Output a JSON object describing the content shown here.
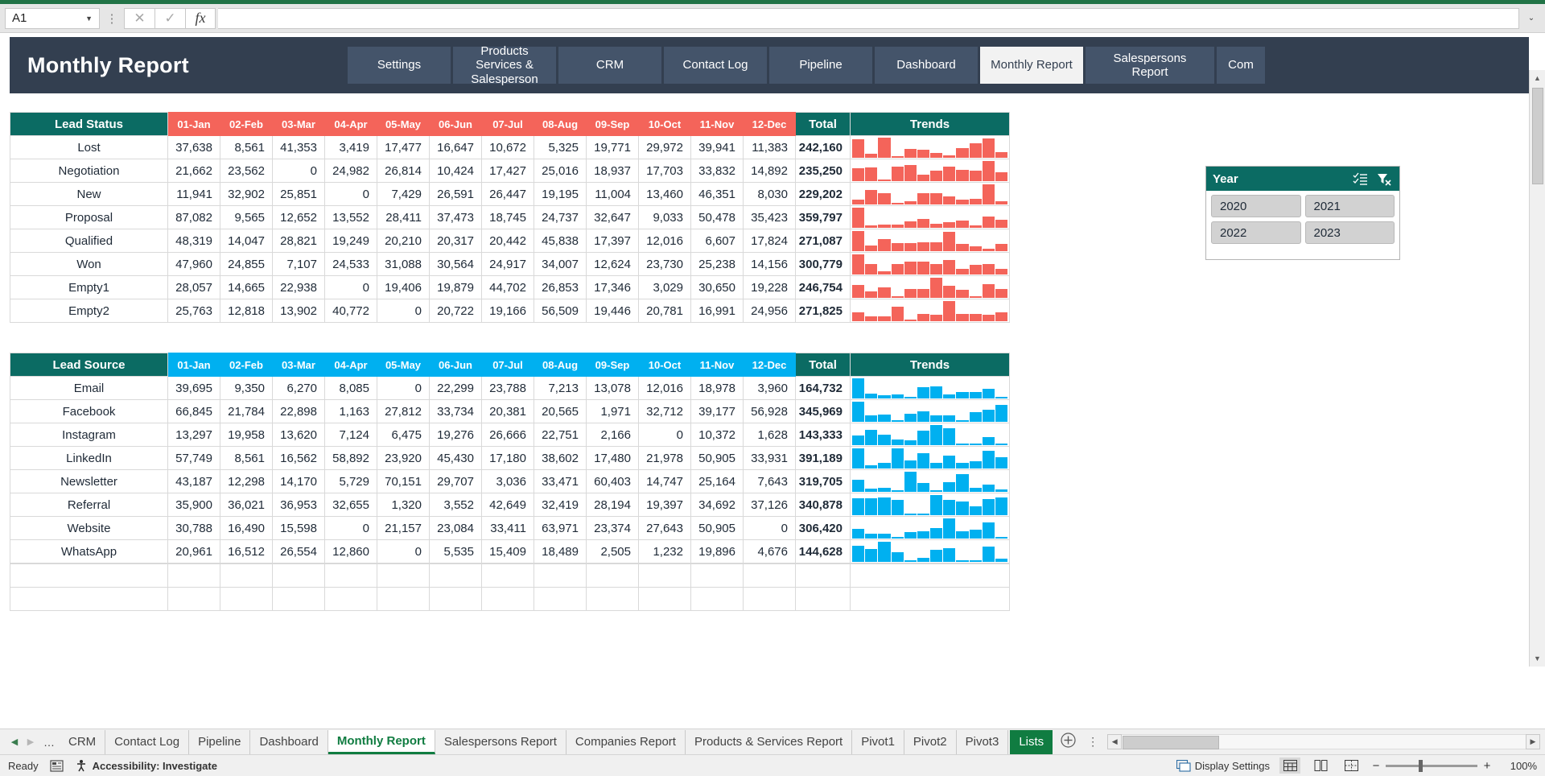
{
  "formula_bar": {
    "name_box_value": "A1",
    "cancel_icon": "close-icon",
    "confirm_icon": "check-icon",
    "fx_label": "fx",
    "formula_value": "",
    "expand_icon": "chevron-down-icon"
  },
  "header": {
    "title": "Monthly Report",
    "tabs": [
      {
        "label": "Settings",
        "active": false
      },
      {
        "label": "Products Services & Salesperson",
        "active": false
      },
      {
        "label": "CRM",
        "active": false
      },
      {
        "label": "Contact Log",
        "active": false
      },
      {
        "label": "Pipeline",
        "active": false
      },
      {
        "label": "Dashboard",
        "active": false
      },
      {
        "label": "Monthly Report",
        "active": true
      },
      {
        "label": "Salespersons Report",
        "active": false
      },
      {
        "label": "Com",
        "active": false
      }
    ]
  },
  "slicer": {
    "title": "Year",
    "multiselect_icon": "multi-select-icon",
    "clear_filter_icon": "clear-filter-icon",
    "items": [
      "2020",
      "2021",
      "2022",
      "2023"
    ]
  },
  "colors": {
    "teal": "#0b6b63",
    "red": "#f4645a",
    "blue": "#00b0f0",
    "navy": "#333f50",
    "tab_navy": "#44546a",
    "excel_green": "#107c41"
  },
  "chart_data": [
    {
      "type": "table",
      "title": "Lead Status",
      "accent": "#f4645a",
      "columns": [
        "Lead Status",
        "01-Jan",
        "02-Feb",
        "03-Mar",
        "04-Apr",
        "05-May",
        "06-Jun",
        "07-Jul",
        "08-Aug",
        "09-Sep",
        "10-Oct",
        "11-Nov",
        "12-Dec",
        "Total",
        "Trends"
      ],
      "categories": [
        "01-Jan",
        "02-Feb",
        "03-Mar",
        "04-Apr",
        "05-May",
        "06-Jun",
        "07-Jul",
        "08-Aug",
        "09-Sep",
        "10-Oct",
        "11-Nov",
        "12-Dec"
      ],
      "rows": [
        {
          "label": "Lost",
          "values": [
            37638,
            8561,
            41353,
            3419,
            17477,
            16647,
            10672,
            5325,
            19771,
            29972,
            39941,
            11383
          ],
          "display": [
            "37,638",
            "8,561",
            "41,353",
            "3,419",
            "17,477",
            "16,647",
            "10,672",
            "5,325",
            "19,771",
            "29,972",
            "39,941",
            "11,383"
          ],
          "total": "242,160"
        },
        {
          "label": "Negotiation",
          "values": [
            21662,
            23562,
            0,
            24982,
            26814,
            10424,
            17427,
            25016,
            18937,
            17703,
            33832,
            14892
          ],
          "display": [
            "21,662",
            "23,562",
            "0",
            "24,982",
            "26,814",
            "10,424",
            "17,427",
            "25,016",
            "18,937",
            "17,703",
            "33,832",
            "14,892"
          ],
          "total": "235,250"
        },
        {
          "label": "New",
          "values": [
            11941,
            32902,
            25851,
            0,
            7429,
            26591,
            26447,
            19195,
            11004,
            13460,
            46351,
            8030
          ],
          "display": [
            "11,941",
            "32,902",
            "25,851",
            "0",
            "7,429",
            "26,591",
            "26,447",
            "19,195",
            "11,004",
            "13,460",
            "46,351",
            "8,030"
          ],
          "total": "229,202"
        },
        {
          "label": "Proposal",
          "values": [
            87082,
            9565,
            12652,
            13552,
            28411,
            37473,
            18745,
            24737,
            32647,
            9033,
            50478,
            35423
          ],
          "display": [
            "87,082",
            "9,565",
            "12,652",
            "13,552",
            "28,411",
            "37,473",
            "18,745",
            "24,737",
            "32,647",
            "9,033",
            "50,478",
            "35,423"
          ],
          "total": "359,797"
        },
        {
          "label": "Qualified",
          "values": [
            48319,
            14047,
            28821,
            19249,
            20210,
            20317,
            20442,
            45838,
            17397,
            12016,
            6607,
            17824
          ],
          "display": [
            "48,319",
            "14,047",
            "28,821",
            "19,249",
            "20,210",
            "20,317",
            "20,442",
            "45,838",
            "17,397",
            "12,016",
            "6,607",
            "17,824"
          ],
          "total": "271,087"
        },
        {
          "label": "Won",
          "values": [
            47960,
            24855,
            7107,
            24533,
            31088,
            30564,
            24917,
            34007,
            12624,
            23730,
            25238,
            14156
          ],
          "display": [
            "47,960",
            "24,855",
            "7,107",
            "24,533",
            "31,088",
            "30,564",
            "24,917",
            "34,007",
            "12,624",
            "23,730",
            "25,238",
            "14,156"
          ],
          "total": "300,779"
        },
        {
          "label": "Empty1",
          "values": [
            28057,
            14665,
            22938,
            0,
            19406,
            19879,
            44702,
            26853,
            17346,
            3029,
            30650,
            19228
          ],
          "display": [
            "28,057",
            "14,665",
            "22,938",
            "0",
            "19,406",
            "19,879",
            "44,702",
            "26,853",
            "17,346",
            "3,029",
            "30,650",
            "19,228"
          ],
          "total": "246,754"
        },
        {
          "label": "Empty2",
          "values": [
            25763,
            12818,
            13902,
            40772,
            0,
            20722,
            19166,
            56509,
            19446,
            20781,
            16991,
            24956
          ],
          "display": [
            "25,763",
            "12,818",
            "13,902",
            "40,772",
            "0",
            "20,722",
            "19,166",
            "56,509",
            "19,446",
            "20,781",
            "16,991",
            "24,956"
          ],
          "total": "271,825"
        }
      ]
    },
    {
      "type": "table",
      "title": "Lead Source",
      "accent": "#00b0f0",
      "columns": [
        "Lead Source",
        "01-Jan",
        "02-Feb",
        "03-Mar",
        "04-Apr",
        "05-May",
        "06-Jun",
        "07-Jul",
        "08-Aug",
        "09-Sep",
        "10-Oct",
        "11-Nov",
        "12-Dec",
        "Total",
        "Trends"
      ],
      "categories": [
        "01-Jan",
        "02-Feb",
        "03-Mar",
        "04-Apr",
        "05-May",
        "06-Jun",
        "07-Jul",
        "08-Aug",
        "09-Sep",
        "10-Oct",
        "11-Nov",
        "12-Dec"
      ],
      "rows": [
        {
          "label": "Email",
          "values": [
            39695,
            9350,
            6270,
            8085,
            0,
            22299,
            23788,
            7213,
            13078,
            12016,
            18978,
            3960
          ],
          "display": [
            "39,695",
            "9,350",
            "6,270",
            "8,085",
            "0",
            "22,299",
            "23,788",
            "7,213",
            "13,078",
            "12,016",
            "18,978",
            "3,960"
          ],
          "total": "164,732"
        },
        {
          "label": "Facebook",
          "values": [
            66845,
            21784,
            22898,
            1163,
            27812,
            33734,
            20381,
            20565,
            1971,
            32712,
            39177,
            56928
          ],
          "display": [
            "66,845",
            "21,784",
            "22,898",
            "1,163",
            "27,812",
            "33,734",
            "20,381",
            "20,565",
            "1,971",
            "32,712",
            "39,177",
            "56,928"
          ],
          "total": "345,969"
        },
        {
          "label": "Instagram",
          "values": [
            13297,
            19958,
            13620,
            7124,
            6475,
            19276,
            26666,
            22751,
            2166,
            0,
            10372,
            1628
          ],
          "display": [
            "13,297",
            "19,958",
            "13,620",
            "7,124",
            "6,475",
            "19,276",
            "26,666",
            "22,751",
            "2,166",
            "0",
            "10,372",
            "1,628"
          ],
          "total": "143,333"
        },
        {
          "label": "LinkedIn",
          "values": [
            57749,
            8561,
            16562,
            58892,
            23920,
            45430,
            17180,
            38602,
            17480,
            21978,
            50905,
            33931
          ],
          "display": [
            "57,749",
            "8,561",
            "16,562",
            "58,892",
            "23,920",
            "45,430",
            "17,180",
            "38,602",
            "17,480",
            "21,978",
            "50,905",
            "33,931"
          ],
          "total": "391,189"
        },
        {
          "label": "Newsletter",
          "values": [
            43187,
            12298,
            14170,
            5729,
            70151,
            29707,
            3036,
            33471,
            60403,
            14747,
            25164,
            7643
          ],
          "display": [
            "43,187",
            "12,298",
            "14,170",
            "5,729",
            "70,151",
            "29,707",
            "3,036",
            "33,471",
            "60,403",
            "14,747",
            "25,164",
            "7,643"
          ],
          "total": "319,705"
        },
        {
          "label": "Referral",
          "values": [
            35900,
            36021,
            36953,
            32655,
            1320,
            3552,
            42649,
            32419,
            28194,
            19397,
            34692,
            37126
          ],
          "display": [
            "35,900",
            "36,021",
            "36,953",
            "32,655",
            "1,320",
            "3,552",
            "42,649",
            "32,419",
            "28,194",
            "19,397",
            "34,692",
            "37,126"
          ],
          "total": "340,878"
        },
        {
          "label": "Website",
          "values": [
            30788,
            16490,
            15598,
            0,
            21157,
            23084,
            33411,
            63971,
            23374,
            27643,
            50905,
            0
          ],
          "display": [
            "30,788",
            "16,490",
            "15,598",
            "0",
            "21,157",
            "23,084",
            "33,411",
            "63,971",
            "23,374",
            "27,643",
            "50,905",
            "0"
          ],
          "total": "306,420"
        },
        {
          "label": "WhatsApp",
          "values": [
            20961,
            16512,
            26554,
            12860,
            0,
            5535,
            15409,
            18489,
            2505,
            1232,
            19896,
            4676
          ],
          "display": [
            "20,961",
            "16,512",
            "26,554",
            "12,860",
            "0",
            "5,535",
            "15,409",
            "18,489",
            "2,505",
            "1,232",
            "19,896",
            "4,676"
          ],
          "total": "144,628"
        }
      ]
    }
  ],
  "sheet_tabs": {
    "prev_icon": "arrow-left-icon",
    "next_icon": "arrow-right-icon",
    "more_icon": "ellipsis-icon",
    "add_icon": "plus-icon",
    "menu_icon": "ellipsis-vertical-icon",
    "items": [
      {
        "label": "CRM",
        "active": false,
        "pill": false
      },
      {
        "label": "Contact Log",
        "active": false,
        "pill": false
      },
      {
        "label": "Pipeline",
        "active": false,
        "pill": false
      },
      {
        "label": "Dashboard",
        "active": false,
        "pill": false
      },
      {
        "label": "Monthly Report",
        "active": true,
        "pill": false
      },
      {
        "label": "Salespersons Report",
        "active": false,
        "pill": false
      },
      {
        "label": "Companies Report",
        "active": false,
        "pill": false
      },
      {
        "label": "Products & Services Report",
        "active": false,
        "pill": false
      },
      {
        "label": "Pivot1",
        "active": false,
        "pill": false
      },
      {
        "label": "Pivot2",
        "active": false,
        "pill": false
      },
      {
        "label": "Pivot3",
        "active": false,
        "pill": false
      },
      {
        "label": "Lists",
        "active": false,
        "pill": true
      }
    ]
  },
  "status_bar": {
    "ready_label": "Ready",
    "record_icon": "macro-record-icon",
    "accessibility_icon": "accessibility-icon",
    "accessibility_label": "Accessibility: Investigate",
    "display_settings_icon": "display-settings-icon",
    "display_settings_label": "Display Settings",
    "view_normal_icon": "normal-view-icon",
    "view_pagelayout_icon": "page-layout-view-icon",
    "view_pagebreak_icon": "page-break-view-icon",
    "zoom_out_label": "−",
    "zoom_in_label": "+",
    "zoom_value": "100%"
  }
}
